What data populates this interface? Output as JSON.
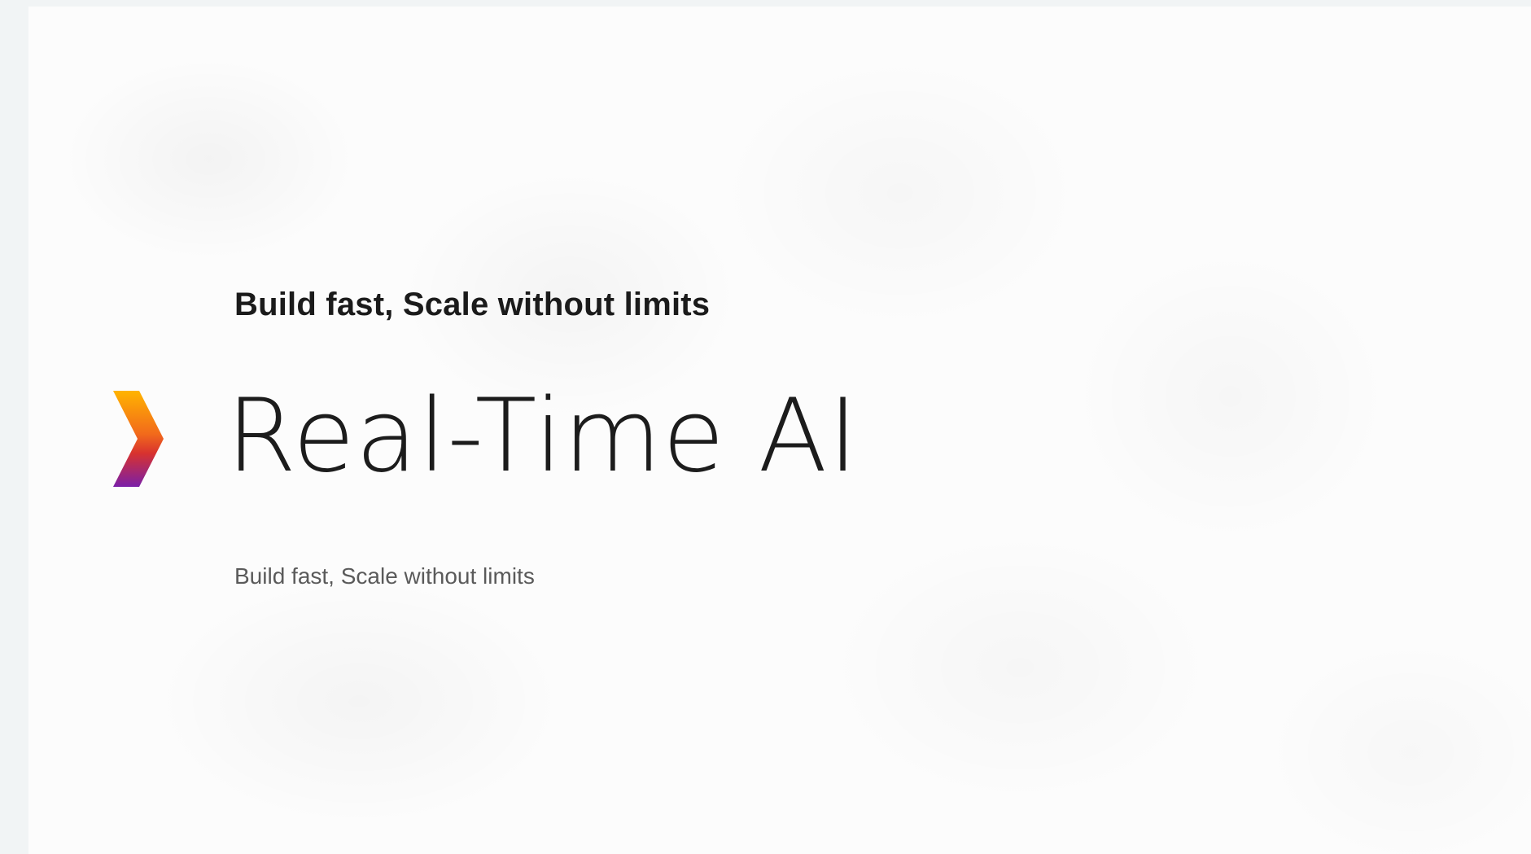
{
  "slide": {
    "eyebrow": "Build fast, Scale without limits",
    "headline": "Real-Time AI",
    "subtitle": "Build fast, Scale without limits",
    "logo_icon": "chevron-right-gradient-icon"
  },
  "colors": {
    "background": "#f1f4f5",
    "slide": "#fcfcfc",
    "text_dark": "#1b1b1b",
    "text_muted": "#5a5a5a",
    "gradient_top": "#ffb400",
    "gradient_mid": "#e8432a",
    "gradient_bottom": "#7a1fa8"
  }
}
